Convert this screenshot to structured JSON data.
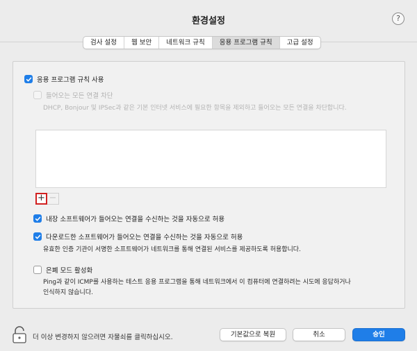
{
  "window": {
    "title": "환경설정",
    "help_symbol": "?"
  },
  "tabs": [
    {
      "label": "검사 설정",
      "active": false
    },
    {
      "label": "웹 보안",
      "active": false
    },
    {
      "label": "네트워크 규칙",
      "active": false
    },
    {
      "label": "응용 프로그램 규칙",
      "active": true
    },
    {
      "label": "고급 설정",
      "active": false
    }
  ],
  "panel": {
    "use_app_rules": {
      "label": "응용 프로그램 규칙 사용",
      "checked": true
    },
    "block_all_incoming": {
      "label": "들어오는 모든 연결 차단",
      "checked": false,
      "enabled": false,
      "description": "DHCP, Bonjour 및 IPSec과 같은 기본 인터넷 서비스에 필요한 항목을 제외하고 들어오는 모든 연결을 차단합니다."
    },
    "list_buttons": {
      "add": "+",
      "remove": "−"
    },
    "allow_builtin": {
      "label": "내장 소프트웨어가 들어오는 연결을 수신하는 것을 자동으로 허용",
      "checked": true
    },
    "allow_downloaded": {
      "label": "다운로드한 소프트웨어가 들어오는 연결을 수신하는 것을 자동으로 허용",
      "checked": true,
      "description": "유효한 인증 기관이 서명한 소프트웨어가 네트워크를 통해 연결된 서비스를 제공하도록 허용합니다."
    },
    "stealth_mode": {
      "label": "은폐 모드 활성화",
      "checked": false,
      "description_line1": "Ping과 같이 ICMP를 사용하는 테스트 응용 프로그램을 통해 네트워크에서 이 컴퓨터에 연결하려는 시도에 응답하거나",
      "description_line2": "인식하지 않습니다."
    }
  },
  "footer": {
    "lock_text": "더 이상 변경하지 않으려면 자물쇠를 클릭하십시오.",
    "restore_label": "기본값으로 복원",
    "cancel_label": "취소",
    "ok_label": "승인"
  },
  "colors": {
    "accent": "#1f7ee8",
    "highlight_box": "#d12020"
  }
}
